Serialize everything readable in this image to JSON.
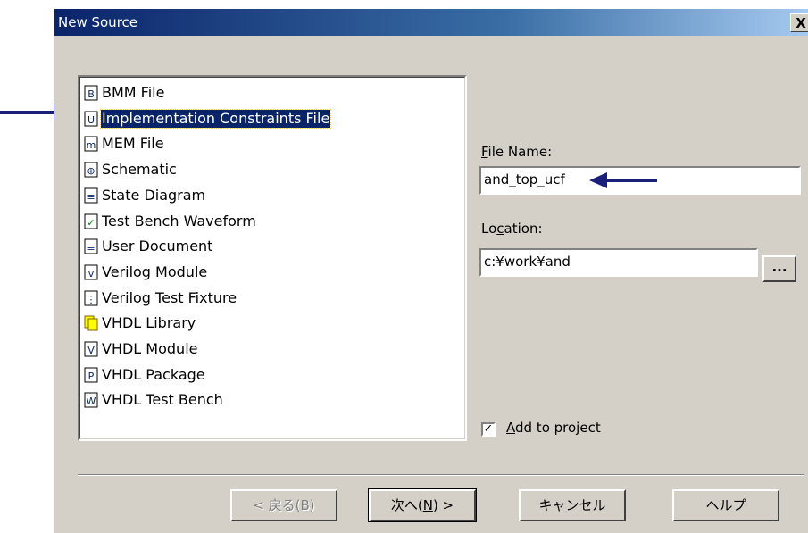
{
  "window": {
    "title": "New Source",
    "close_label": "X"
  },
  "source_types": [
    {
      "label": "BMM File",
      "icon": "bmm-file-icon",
      "selected": false
    },
    {
      "label": "Implementation Constraints File",
      "icon": "constraints-file-icon",
      "selected": true
    },
    {
      "label": "MEM File",
      "icon": "mem-file-icon",
      "selected": false
    },
    {
      "label": "Schematic",
      "icon": "schematic-icon",
      "selected": false
    },
    {
      "label": "State Diagram",
      "icon": "state-diagram-icon",
      "selected": false
    },
    {
      "label": "Test Bench Waveform",
      "icon": "waveform-icon",
      "selected": false
    },
    {
      "label": "User Document",
      "icon": "document-icon",
      "selected": false
    },
    {
      "label": "Verilog Module",
      "icon": "verilog-module-icon",
      "selected": false
    },
    {
      "label": "Verilog Test Fixture",
      "icon": "verilog-fixture-icon",
      "selected": false
    },
    {
      "label": "VHDL Library",
      "icon": "vhdl-library-icon",
      "selected": false
    },
    {
      "label": "VHDL Module",
      "icon": "vhdl-module-icon",
      "selected": false
    },
    {
      "label": "VHDL Package",
      "icon": "vhdl-package-icon",
      "selected": false
    },
    {
      "label": "VHDL Test Bench",
      "icon": "vhdl-testbench-icon",
      "selected": false
    }
  ],
  "file_name": {
    "label_prefix": "",
    "label_accel": "F",
    "label_rest": "ile Name:",
    "value": "and_top_ucf"
  },
  "location": {
    "label_prefix": "Lo",
    "label_accel": "c",
    "label_rest": "ation:",
    "value": "c:¥work¥and",
    "browse_label": "..."
  },
  "add_to_project": {
    "checked": true,
    "mark": "✓",
    "label_accel": "A",
    "label_rest": "dd to project"
  },
  "buttons": {
    "back": "< 戻る(B)",
    "next_prefix": "次へ(",
    "next_accel": "N",
    "next_suffix": ") >",
    "cancel": "キャンセル",
    "help": "ヘルプ"
  },
  "colors": {
    "selection": "#0a246a",
    "dialog_bg": "#d4d0c8",
    "arrow": "#1a1f7a"
  }
}
